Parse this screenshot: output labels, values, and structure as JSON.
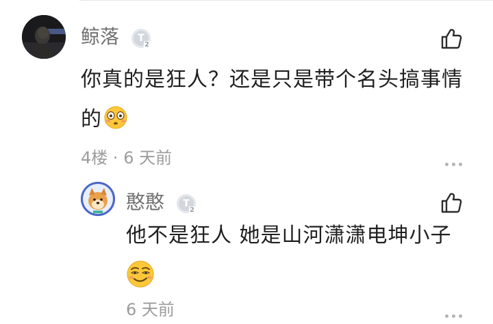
{
  "comments": [
    {
      "username": "鲸落",
      "level_badge": "T",
      "level_number": "2",
      "text": "你真的是狂人？还是只是带个名头搞事情的",
      "emoji": "flushed-face-emoji",
      "floor": "4楼",
      "separator": "·",
      "time": "6 天前",
      "reply": {
        "username": "憨憨",
        "level_badge": "T",
        "level_number": "2",
        "text": "他不是狂人 她是山河潇潇电坤小子",
        "emoji": "smirking-face-emoji",
        "time": "6 天前"
      }
    }
  ],
  "icons": {
    "like": "thumbs-up-icon",
    "more": "more-dots-icon"
  },
  "colors": {
    "username": "#707070",
    "text": "#1f1f1f",
    "meta": "#9c9c9c",
    "badge": "#d3d7dd"
  }
}
